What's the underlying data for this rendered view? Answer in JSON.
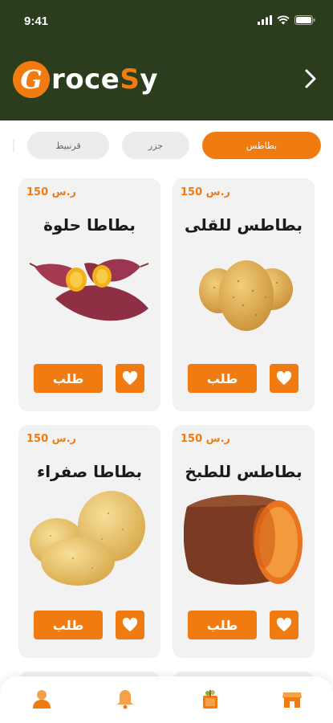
{
  "status_bar": {
    "time": "9:41"
  },
  "header": {
    "logo_initial": "G",
    "logo_text_a": "roce",
    "logo_text_s": "S",
    "logo_text_b": "y"
  },
  "tabs": [
    {
      "label": "بطاطس",
      "active": true
    },
    {
      "label": "جزر",
      "active": false
    },
    {
      "label": "قرنبيط",
      "active": false
    }
  ],
  "products": [
    {
      "name": "بطاطس للقلى",
      "price": "150 ر.س",
      "order_label": "طلب",
      "image_icon": "potatoes-image"
    },
    {
      "name": "بطاطا حلوة",
      "price": "150 ر.س",
      "order_label": "طلب",
      "image_icon": "sweet-potatoes-image"
    },
    {
      "name": "بطاطس للطبخ",
      "price": "150 ر.س",
      "order_label": "طلب",
      "image_icon": "cooking-potato-image"
    },
    {
      "name": "بطاطا صفراء",
      "price": "150 ر.س",
      "order_label": "طلب",
      "image_icon": "yellow-potatoes-image"
    }
  ],
  "bottom_nav": [
    {
      "icon": "store-icon"
    },
    {
      "icon": "grocery-bag-icon"
    },
    {
      "icon": "bell-icon"
    },
    {
      "icon": "profile-icon"
    }
  ],
  "colors": {
    "accent": "#f07c11",
    "header_bg": "#2c3d1d",
    "card_bg": "#f2f2f2"
  }
}
